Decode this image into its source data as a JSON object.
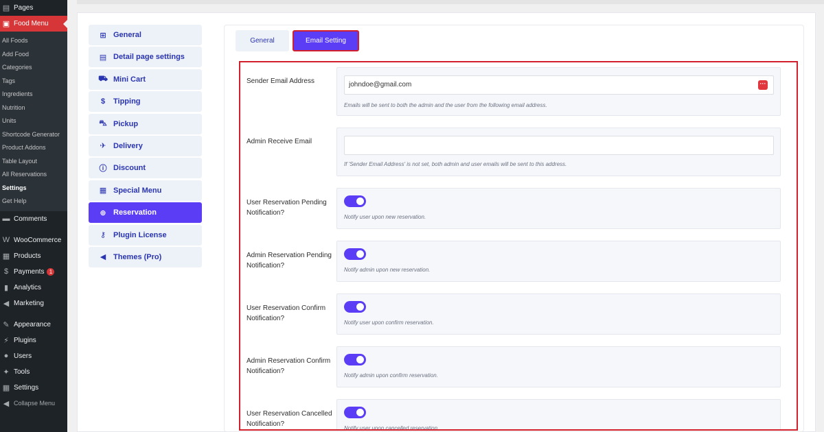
{
  "wp_menu": {
    "pages": "Pages",
    "food_menu": "Food Menu",
    "submenu": [
      "All Foods",
      "Add Food",
      "Categories",
      "Tags",
      "Ingredients",
      "Nutrition",
      "Units",
      "Shortcode Generator",
      "Product Addons",
      "Table Layout",
      "All Reservations",
      "Settings",
      "Get Help"
    ],
    "comments": "Comments",
    "woocommerce": "WooCommerce",
    "products": "Products",
    "payments": "Payments",
    "payments_badge": "1",
    "analytics": "Analytics",
    "marketing": "Marketing",
    "appearance": "Appearance",
    "plugins": "Plugins",
    "users": "Users",
    "tools": "Tools",
    "settings": "Settings",
    "collapse": "Collapse Menu"
  },
  "plugin_nav": [
    {
      "label": "General",
      "icon": "grid-plus-icon"
    },
    {
      "label": "Detail page settings",
      "icon": "document-icon"
    },
    {
      "label": "Mini Cart",
      "icon": "cart-icon"
    },
    {
      "label": "Tipping",
      "icon": "dollar-icon"
    },
    {
      "label": "Pickup",
      "icon": "car-icon"
    },
    {
      "label": "Delivery",
      "icon": "plane-icon"
    },
    {
      "label": "Discount",
      "icon": "info-icon"
    },
    {
      "label": "Special Menu",
      "icon": "table-icon"
    },
    {
      "label": "Reservation",
      "icon": "plus-circle-icon"
    },
    {
      "label": "Plugin License",
      "icon": "key-icon"
    },
    {
      "label": "Themes (Pro)",
      "icon": "megaphone-icon"
    }
  ],
  "tabs": {
    "general": "General",
    "email": "Email Setting"
  },
  "fields": {
    "sender": {
      "label": "Sender Email Address",
      "value": "johndoe@gmail.com",
      "help": "Emails will be sent to both the admin and the user from the following email address."
    },
    "admin_receive": {
      "label": "Admin Receive Email",
      "value": "",
      "help": "If 'Sender Email Address' is not set, both admin and user emails will be sent to this address."
    },
    "toggles": [
      {
        "label": "User Reservation Pending Notification?",
        "help": "Notify user upon new reservation.",
        "on": true
      },
      {
        "label": "Admin Reservation Pending Notification?",
        "help": "Notify admin upon new reservation.",
        "on": true
      },
      {
        "label": "User Reservation Confirm Notification?",
        "help": "Notify user upon confirm reservation.",
        "on": true
      },
      {
        "label": "Admin Reservation Confirm Notification?",
        "help": "Notify admin upon confirm reservation.",
        "on": true
      },
      {
        "label": "User Reservation Cancelled Notification?",
        "help": "Notify user upon cancelled reservation.",
        "on": true
      }
    ]
  },
  "colors": {
    "accent": "#5b3df5",
    "highlight": "#d21f2c",
    "wp_sidebar": "#1d2327"
  }
}
